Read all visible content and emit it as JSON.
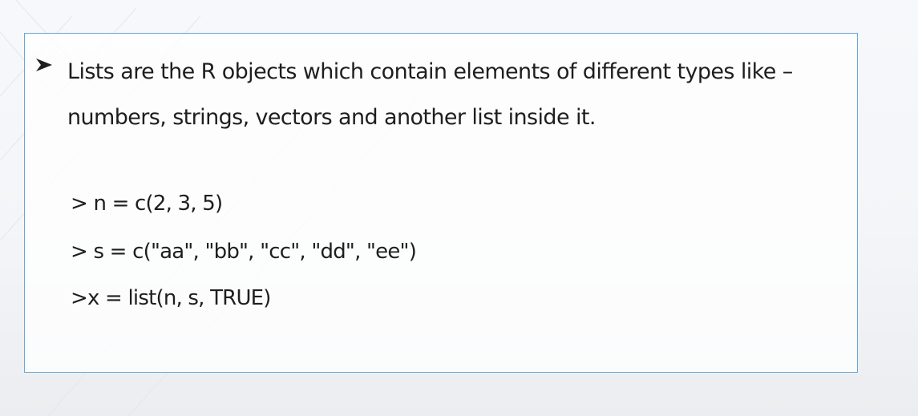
{
  "slide": {
    "bullet_icon": "arrow-bullet-icon",
    "bullet_text": "Lists are the R objects which contain elements of different types like – numbers, strings, vectors and another list inside it.",
    "code_lines": [
      "> n = c(2, 3, 5)",
      "> s = c(\"aa\", \"bb\", \"cc\", \"dd\", \"ee\")",
      ">x = list(n, s, TRUE)"
    ]
  },
  "colors": {
    "border": "#6aa6d6",
    "text": "#1e1e1e"
  }
}
